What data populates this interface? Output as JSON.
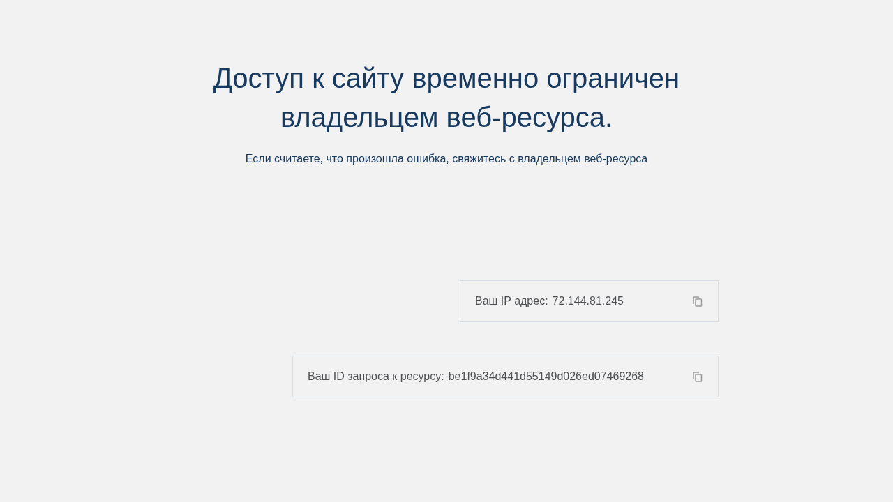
{
  "heading": "Доступ к сайту временно ограничен владельцем веб-ресурса.",
  "subheading": "Если считаете, что произошла ошибка, свяжитесь с владельцем веб-ресурса",
  "info_fields": [
    {
      "label": "Ваш IP адрес:",
      "value": "72.144.81.245"
    },
    {
      "label": "Ваш ID запроса к ресурсу:",
      "value": "be1f9a34d441d55149d026ed07469268"
    }
  ]
}
